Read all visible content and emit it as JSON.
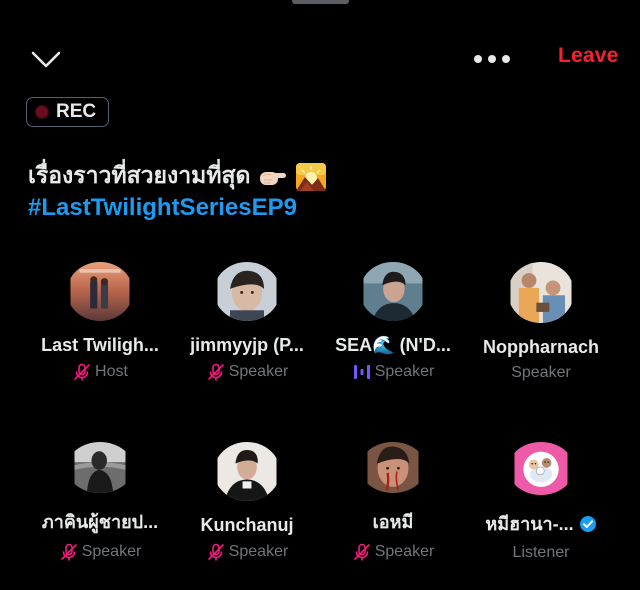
{
  "header": {
    "leave_label": "Leave",
    "collapse_icon": "chevron-down-icon",
    "more_icon": "more-dots-icon"
  },
  "recording": {
    "label": "REC"
  },
  "space": {
    "title": "เรื่องราวที่สวยงามที่สุด",
    "title_emojis": [
      "backhand-index-pointing-right",
      "sunrise-over-mountains"
    ],
    "hashtag": "#LastTwilightSeriesEP9"
  },
  "participants": [
    {
      "name": "Last Twiligh...",
      "role": "Host",
      "role_icon": "mic-muted-icon"
    },
    {
      "name": "jimmyyjp (P...",
      "role": "Speaker",
      "role_icon": "mic-muted-icon"
    },
    {
      "name": "SEA🌊 (N'D...",
      "role": "Speaker",
      "role_icon": "speaking-bars-icon"
    },
    {
      "name": "Noppharnach",
      "role": "Speaker",
      "role_icon": ""
    },
    {
      "name": "ภาคินผู้ชายป...",
      "role": "Speaker",
      "role_icon": "mic-muted-icon"
    },
    {
      "name": "Kunchanuj",
      "role": "Speaker",
      "role_icon": "mic-muted-icon"
    },
    {
      "name": "เอหมี",
      "role": "Speaker",
      "role_icon": "mic-muted-icon"
    },
    {
      "name": "หมีฮานา-...",
      "role": "Listener",
      "role_icon": "",
      "verified": true
    }
  ],
  "colors": {
    "background": "#000000",
    "leave": "#f4212e",
    "hashtag": "#1d9bf0",
    "muted_mic": "#f91880",
    "speaking": "#7856ff",
    "secondary_text": "#71767b"
  }
}
